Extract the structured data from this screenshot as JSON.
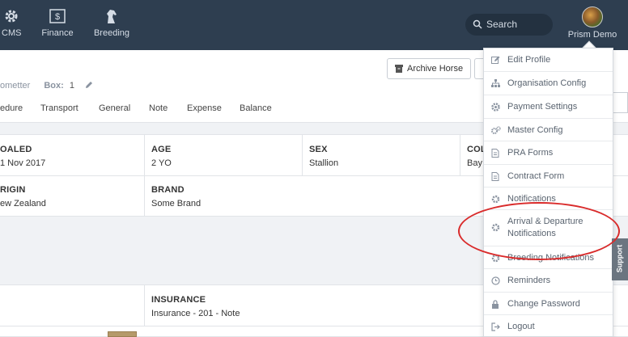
{
  "topbar": {
    "nav": [
      {
        "label": "CMS",
        "icon": "gear-icon"
      },
      {
        "label": "Finance",
        "icon": "money-icon"
      },
      {
        "label": "Breeding",
        "icon": "horse-icon"
      }
    ],
    "search_label": "Search",
    "user_name": "Prism Demo"
  },
  "header": {
    "meta_partial": "ometter",
    "box_label": "Box:",
    "box_value": "1",
    "archive_button": "Archive Horse",
    "tabs": [
      "edure",
      "Transport",
      "General",
      "Note",
      "Expense",
      "Balance"
    ]
  },
  "details": {
    "row1": [
      {
        "label": "OALED",
        "value": "1 Nov 2017"
      },
      {
        "label": "AGE",
        "value": "2 YO"
      },
      {
        "label": "SEX",
        "value": "Stallion"
      },
      {
        "label": "COL",
        "value": "Bay"
      }
    ],
    "row2": [
      {
        "label": "RIGIN",
        "value": "ew Zealand"
      },
      {
        "label": "BRAND",
        "value": "Some Brand"
      }
    ],
    "insurance": {
      "label": "INSURANCE",
      "value": "Insurance - 201 - Note"
    }
  },
  "menu": {
    "items": [
      {
        "label": "Edit Profile",
        "icon": "pencil-square-icon"
      },
      {
        "label": "Organisation Config",
        "icon": "sitemap-icon"
      },
      {
        "label": "Payment Settings",
        "icon": "cog-icon"
      },
      {
        "label": "Master Config",
        "icon": "cogs-icon"
      },
      {
        "label": "PRA Forms",
        "icon": "document-icon"
      },
      {
        "label": "Contract Form",
        "icon": "document-icon"
      },
      {
        "label": "Notifications",
        "icon": "cog-icon"
      },
      {
        "label": "Arrival & Departure Notifications",
        "icon": "cog-icon"
      },
      {
        "label": "Breeding Notifications",
        "icon": "cog-icon"
      },
      {
        "label": "Reminders",
        "icon": "clock-icon"
      },
      {
        "label": "Change Password",
        "icon": "lock-icon"
      },
      {
        "label": "Logout",
        "icon": "sign-out-icon"
      }
    ]
  },
  "support_label": "Support",
  "colors": {
    "topbar": "#2e3e50",
    "highlight": "#d92b2b",
    "menu_text": "#5a6470"
  }
}
